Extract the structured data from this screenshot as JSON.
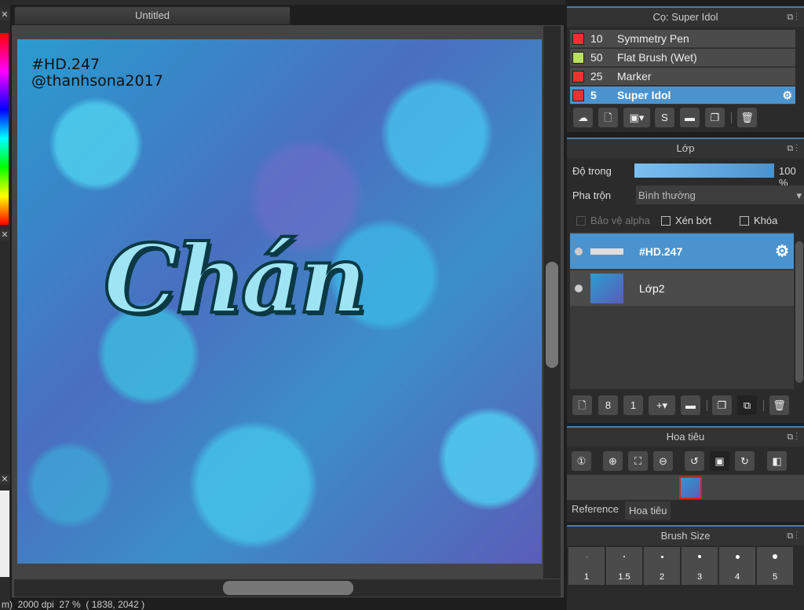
{
  "document": {
    "tab_title": "Untitled",
    "watermark_line1": "#HD.247",
    "watermark_line2": "@thanhsona2017",
    "lettering": "Chán"
  },
  "status": {
    "text": "m)  2000 dpi  27 %  ( 1838, 2042 )"
  },
  "brush_panel": {
    "title": "Cọ: Super Idol",
    "brushes": [
      {
        "size": "10",
        "name": "Symmetry Pen",
        "color": "#f03030"
      },
      {
        "size": "50",
        "name": "Flat Brush (Wet)",
        "color": "#b8e060"
      },
      {
        "size": "25",
        "name": "Marker",
        "color": "#f03030"
      },
      {
        "size": "5",
        "name": "Super Idol",
        "color": "#f03030",
        "selected": true
      }
    ]
  },
  "layer_panel": {
    "title": "Lớp",
    "opacity_label": "Độ trong",
    "opacity_value": "100 %",
    "opacity_percent": 100,
    "blend_label": "Pha trộn",
    "blend_value": "Bình thường",
    "protect_alpha": "Bảo vệ alpha",
    "clipping": "Xén bớt",
    "lock": "Khóa",
    "layers": [
      {
        "name": "#HD.247",
        "selected": true
      },
      {
        "name": "Lớp2"
      }
    ]
  },
  "navigator_panel": {
    "title": "Hoa tiêu",
    "tabs": [
      "Reference",
      "Hoa tiêu"
    ]
  },
  "brush_size_panel": {
    "title": "Brush Size",
    "sizes": [
      "1",
      "1.5",
      "2",
      "3",
      "4",
      "5"
    ]
  },
  "colors": {
    "accent": "#4b93cf"
  }
}
